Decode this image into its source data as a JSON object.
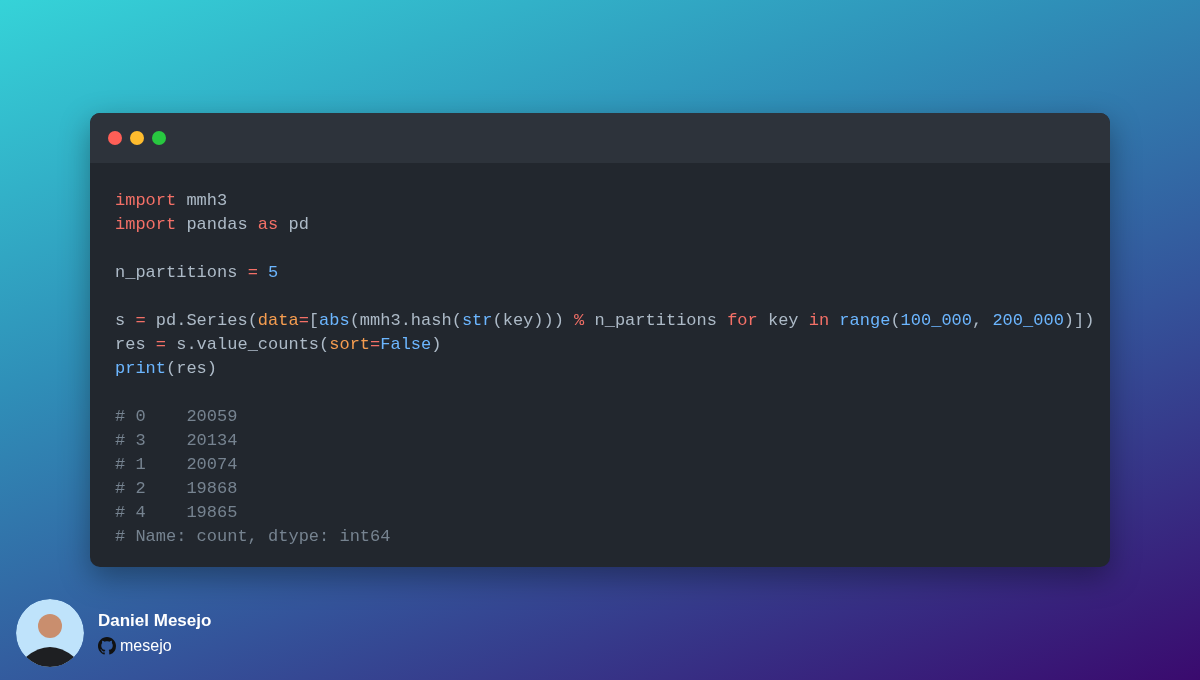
{
  "window": {
    "controls": [
      {
        "color": "#ff5f57"
      },
      {
        "color": "#febc2e"
      },
      {
        "color": "#28c840"
      }
    ]
  },
  "code_blocks": [
    [
      [
        {
          "text": "import",
          "kind": "keyword"
        },
        {
          "text": " mmh3",
          "kind": "plain"
        }
      ],
      [
        {
          "text": "import",
          "kind": "keyword"
        },
        {
          "text": " pandas ",
          "kind": "plain"
        },
        {
          "text": "as",
          "kind": "keyword"
        },
        {
          "text": " pd",
          "kind": "plain"
        }
      ]
    ],
    [
      [
        {
          "text": "n_partitions ",
          "kind": "plain"
        },
        {
          "text": "=",
          "kind": "operator"
        },
        {
          "text": " 5",
          "kind": "number"
        }
      ]
    ],
    [
      [
        {
          "text": "s ",
          "kind": "plain"
        },
        {
          "text": "=",
          "kind": "operator"
        },
        {
          "text": " pd.Series(",
          "kind": "plain"
        },
        {
          "text": "data",
          "kind": "param"
        },
        {
          "text": "=",
          "kind": "operator"
        },
        {
          "text": "[",
          "kind": "plain"
        },
        {
          "text": "abs",
          "kind": "builtin"
        },
        {
          "text": "(mmh3.hash(",
          "kind": "plain"
        },
        {
          "text": "str",
          "kind": "builtin"
        },
        {
          "text": "(key))) ",
          "kind": "plain"
        },
        {
          "text": "%",
          "kind": "operator"
        },
        {
          "text": " n_partitions ",
          "kind": "plain"
        },
        {
          "text": "for",
          "kind": "keyword"
        },
        {
          "text": " key ",
          "kind": "plain"
        },
        {
          "text": "in",
          "kind": "keyword"
        },
        {
          "text": " range",
          "kind": "builtin"
        },
        {
          "text": "(",
          "kind": "plain"
        },
        {
          "text": "100_000",
          "kind": "number"
        },
        {
          "text": ", ",
          "kind": "plain"
        },
        {
          "text": "200_000",
          "kind": "number"
        },
        {
          "text": ")])",
          "kind": "plain"
        }
      ],
      [
        {
          "text": "res ",
          "kind": "plain"
        },
        {
          "text": "=",
          "kind": "operator"
        },
        {
          "text": " s.value_counts(",
          "kind": "plain"
        },
        {
          "text": "sort",
          "kind": "param"
        },
        {
          "text": "=",
          "kind": "operator"
        },
        {
          "text": "False",
          "kind": "number"
        },
        {
          "text": ")",
          "kind": "plain"
        }
      ],
      [
        {
          "text": "print",
          "kind": "builtin"
        },
        {
          "text": "(res)",
          "kind": "plain"
        }
      ]
    ],
    [
      [
        {
          "text": "# 0    20059",
          "kind": "comment"
        }
      ],
      [
        {
          "text": "# 3    20134",
          "kind": "comment"
        }
      ],
      [
        {
          "text": "# 1    20074",
          "kind": "comment"
        }
      ],
      [
        {
          "text": "# 2    19868",
          "kind": "comment"
        }
      ],
      [
        {
          "text": "# 4    19865",
          "kind": "comment"
        }
      ],
      [
        {
          "text": "# Name: count, dtype: int64",
          "kind": "comment"
        }
      ]
    ]
  ],
  "author": {
    "name": "Daniel Mesejo",
    "handle": "mesejo"
  }
}
